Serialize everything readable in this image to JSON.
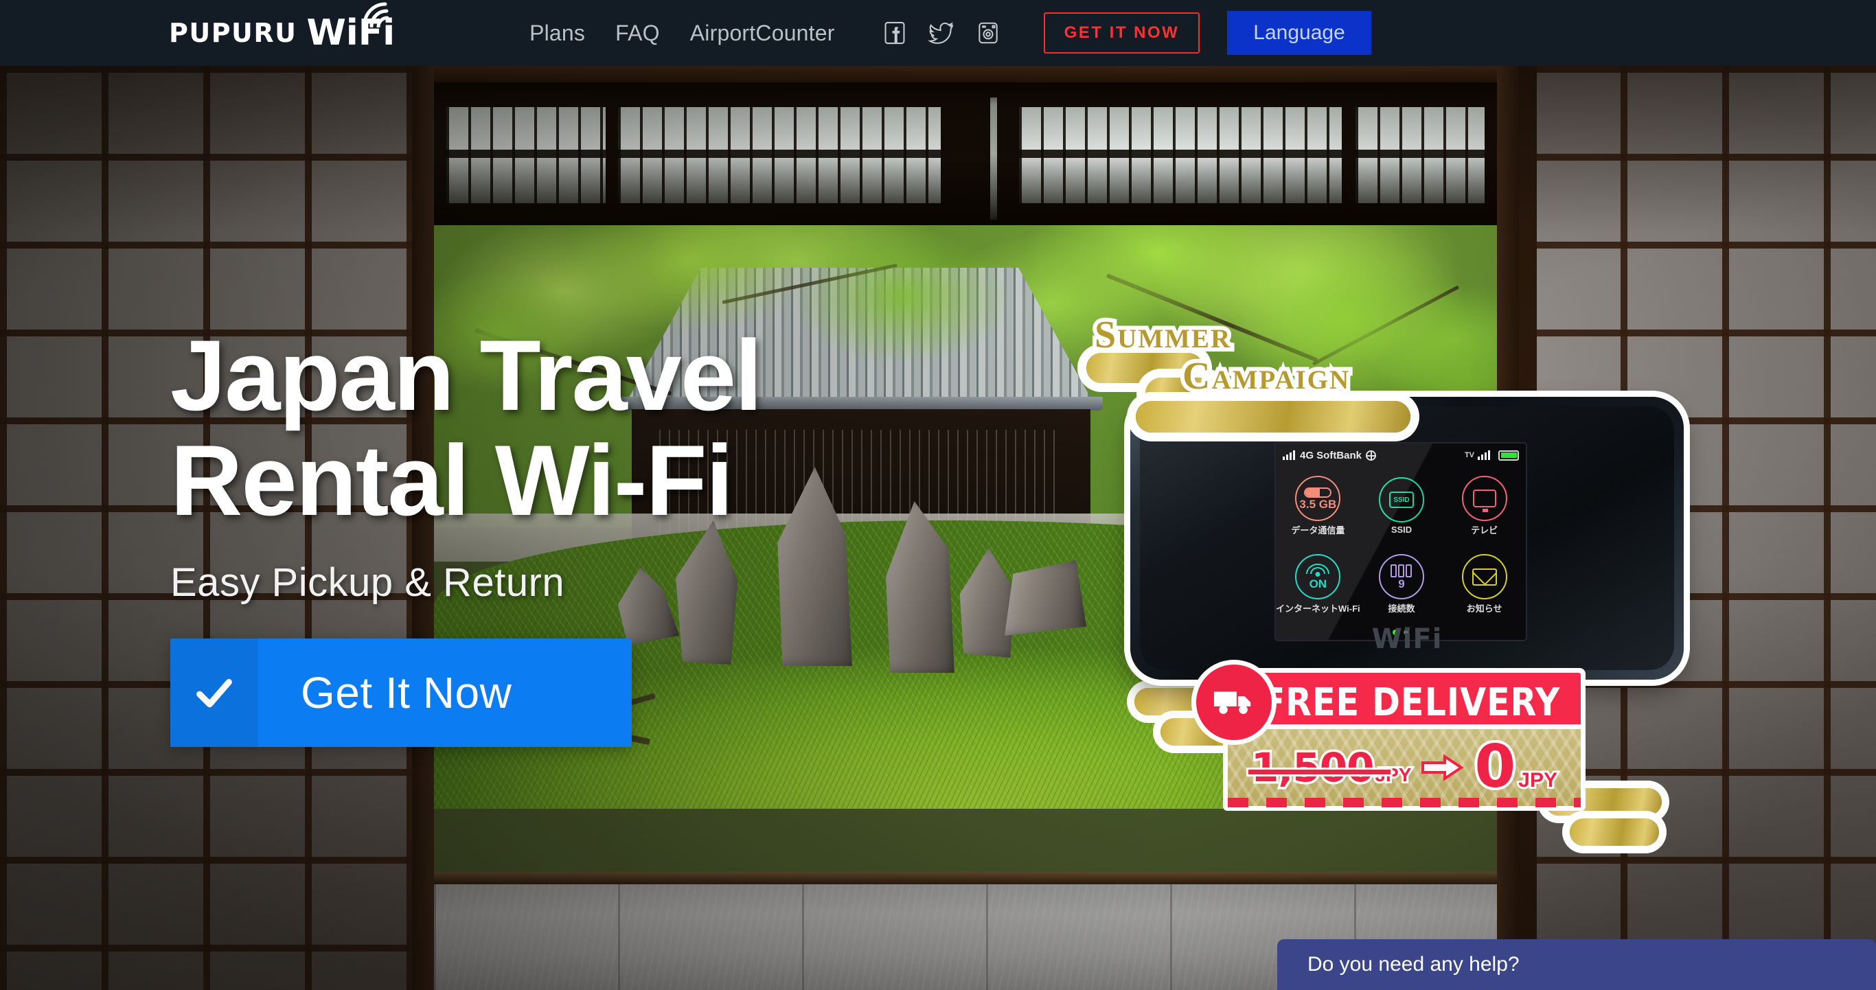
{
  "header": {
    "logo_primary": "PuPuRu",
    "logo_secondary": "WiFi",
    "logo_icon": "wifi-signal-icon",
    "nav": [
      {
        "label": "Plans"
      },
      {
        "label": "FAQ"
      },
      {
        "label": "AirportCounter"
      }
    ],
    "socials": [
      {
        "name": "facebook-icon"
      },
      {
        "name": "twitter-icon"
      },
      {
        "name": "instagram-icon"
      }
    ],
    "get_it_now_label": "GET IT NOW",
    "language_label": "Language",
    "bar_color": "#131c24",
    "get_it_now_color": "#ff3030",
    "language_color": "#0b33c9"
  },
  "hero": {
    "headline_line1": "Japan Travel",
    "headline_line2": "Rental Wi-Fi",
    "subtitle": "Easy Pickup & Return",
    "cta_label": "Get It Now",
    "cta_icon": "check-icon",
    "cta_color": "#0c7cf2"
  },
  "campaign_badge": {
    "word1": "Summer",
    "word2": "Campaign",
    "gold": "#b69a30"
  },
  "device": {
    "brand": "WiFi",
    "screen": {
      "network": "4G SoftBank",
      "signal_icon": "signal-bars-icon",
      "globe_icon": "globe-icon",
      "tv_label": "TV",
      "battery_icon": "battery-full-icon",
      "tiles": [
        {
          "value": "3.5 GB",
          "label": "データ通信量",
          "icon": "data-pill-icon",
          "color": "#f2826a"
        },
        {
          "value": "SSID",
          "label": "SSID",
          "icon": "ssid-icon",
          "color": "#14d99b"
        },
        {
          "value": "",
          "label": "テレビ",
          "icon": "tv-icon",
          "color": "#f2607a"
        },
        {
          "value": "ON",
          "label": "インターネットWi-Fi",
          "icon": "wifi-icon",
          "color": "#12d6c0"
        },
        {
          "value": "9",
          "label": "接続数",
          "icon": "devices-icon",
          "color": "#b39ae6"
        },
        {
          "value": "",
          "label": "お知らせ",
          "icon": "mail-icon",
          "color": "#d4d124"
        }
      ],
      "page_dots": 2,
      "active_dot": 1
    }
  },
  "promo": {
    "banner_text": "FREE DELIVERY",
    "truck_icon": "delivery-truck-icon",
    "arrow_icon": "right-arrow-icon",
    "old_price": "1,500",
    "old_currency": "JPY",
    "new_price": "0",
    "new_currency": "JPY",
    "banner_color": "#f5294a"
  },
  "chat": {
    "message": "Do you need any help?",
    "bg_color": "#3b4589"
  }
}
